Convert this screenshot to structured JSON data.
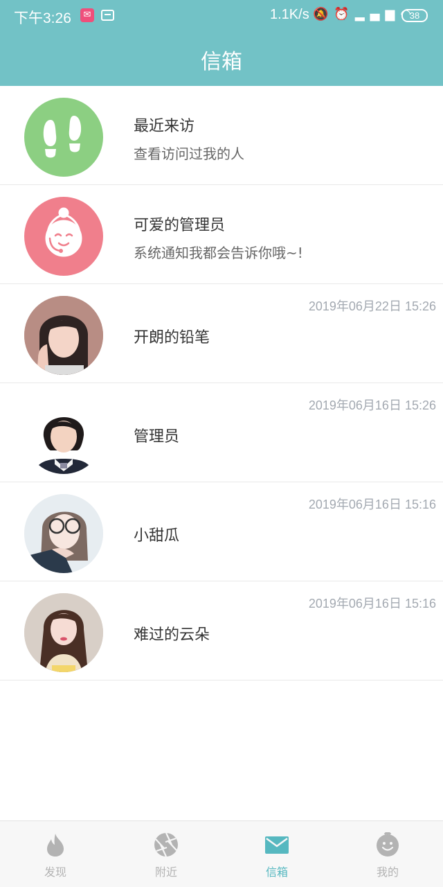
{
  "status_bar": {
    "time": "下午3:26",
    "speed": "1.1K/s",
    "icons": [
      "bell-off-icon",
      "alarm-icon",
      "signal-icon",
      "wifi-icon"
    ],
    "battery": "38"
  },
  "header": {
    "title": "信箱"
  },
  "rows": [
    {
      "type": "system",
      "name": "最近来访",
      "subtitle": "查看访问过我的人",
      "avatar": "footprints-icon",
      "avatar_color": "#8ccf82"
    },
    {
      "type": "system",
      "name": "可爱的管理员",
      "subtitle": "系统通知我都会告诉你哦~!",
      "avatar": "admin-face-icon",
      "avatar_color": "#f07f8c"
    },
    {
      "type": "message",
      "name": "开朗的铅笔",
      "time": "2019年06月22日 15:26"
    },
    {
      "type": "message",
      "name": "管理员",
      "time": "2019年06月16日 15:26"
    },
    {
      "type": "message",
      "name": "小甜瓜",
      "time": "2019年06月16日 15:16"
    },
    {
      "type": "message",
      "name": "难过的云朵",
      "time": "2019年06月16日 15:16"
    }
  ],
  "tabs": [
    {
      "label": "发现",
      "icon": "flame-icon",
      "active": false
    },
    {
      "label": "附近",
      "icon": "aperture-icon",
      "active": false
    },
    {
      "label": "信箱",
      "icon": "mail-icon",
      "active": true
    },
    {
      "label": "我的",
      "icon": "smiley-icon",
      "active": false
    }
  ],
  "colors": {
    "accent": "#72c2c6",
    "active_tab": "#56b8c0",
    "inactive_tab": "#b3b3b3"
  }
}
